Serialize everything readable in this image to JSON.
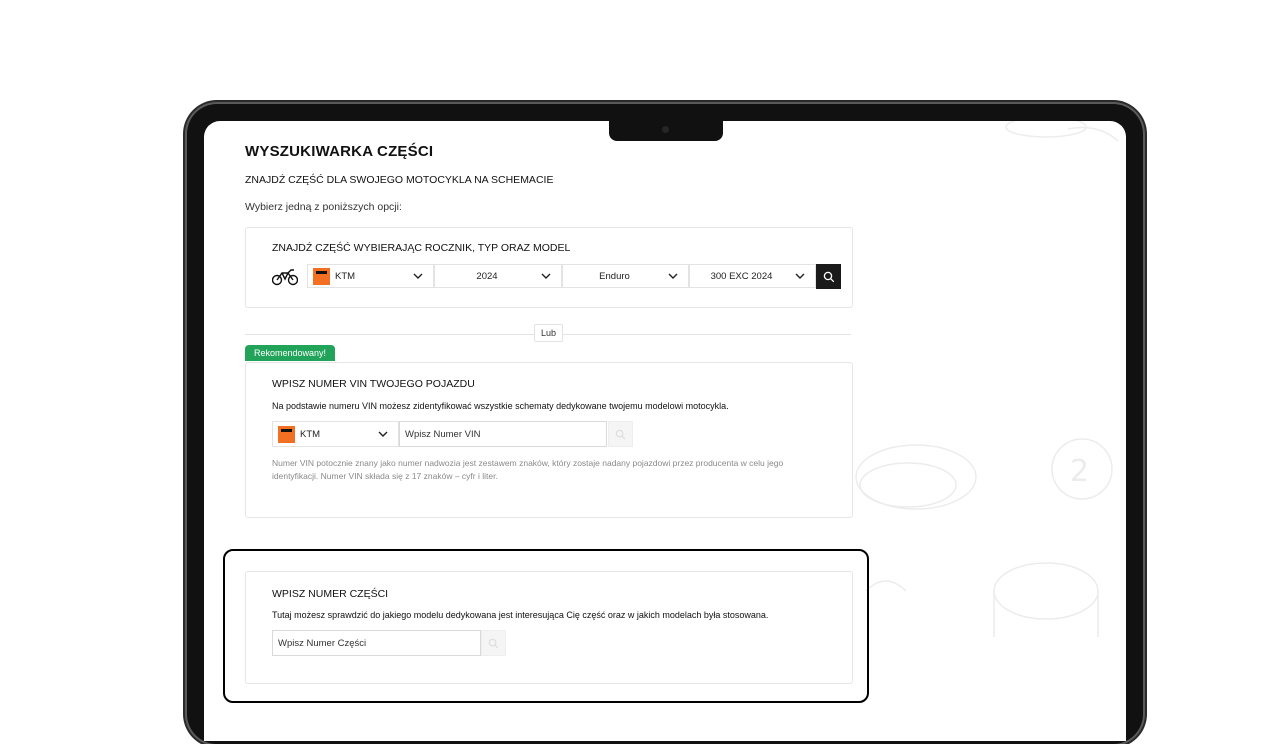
{
  "page": {
    "title": "WYSZUKIWARKA CZĘŚCI",
    "subtitle": "ZNAJDŹ CZĘŚĆ DLA SWOJEGO MOTOCYKLA NA SCHEMACIE",
    "intro": "Wybierz jedną z poniższych opcji:"
  },
  "model_search": {
    "title": "ZNAJDŹ CZĘŚĆ WYBIERAJĄC ROCZNIK, TYP ORAZ MODEL",
    "brand": "KTM",
    "year": "2024",
    "type": "Enduro",
    "model": "300 EXC 2024"
  },
  "separator": {
    "label": "Lub"
  },
  "vin_search": {
    "badge": "Rekomendowany!",
    "title": "WPISZ NUMER VIN TWOJEGO POJAZDU",
    "description": "Na podstawie numeru VIN możesz zidentyfikować wszystkie schematy dedykowane twojemu modelowi motocykla.",
    "brand": "KTM",
    "input_value": "Wpisz Numer VIN",
    "note": "Numer VIN potocznie znany jako numer nadwozia jest zestawem znaków, który zostaje nadany pojazdowi przez producenta w celu jego identyfikacji. Numer VIN składa się z 17 znaków – cyfr i liter."
  },
  "part_search": {
    "title": "WPISZ NUMER CZĘŚCI",
    "description": "Tutaj możesz sprawdzić do jakiego modelu dedykowana jest interesująca Cię część oraz w jakich modelach była stosowana.",
    "input_value": "Wpisz Numer Części"
  },
  "colors": {
    "accent_green": "#22a35a",
    "brand_orange": "#f36f21",
    "button_dark": "#1a1a1a"
  },
  "icons": [
    "motorcycle-icon",
    "chevron-down-icon",
    "search-icon"
  ]
}
